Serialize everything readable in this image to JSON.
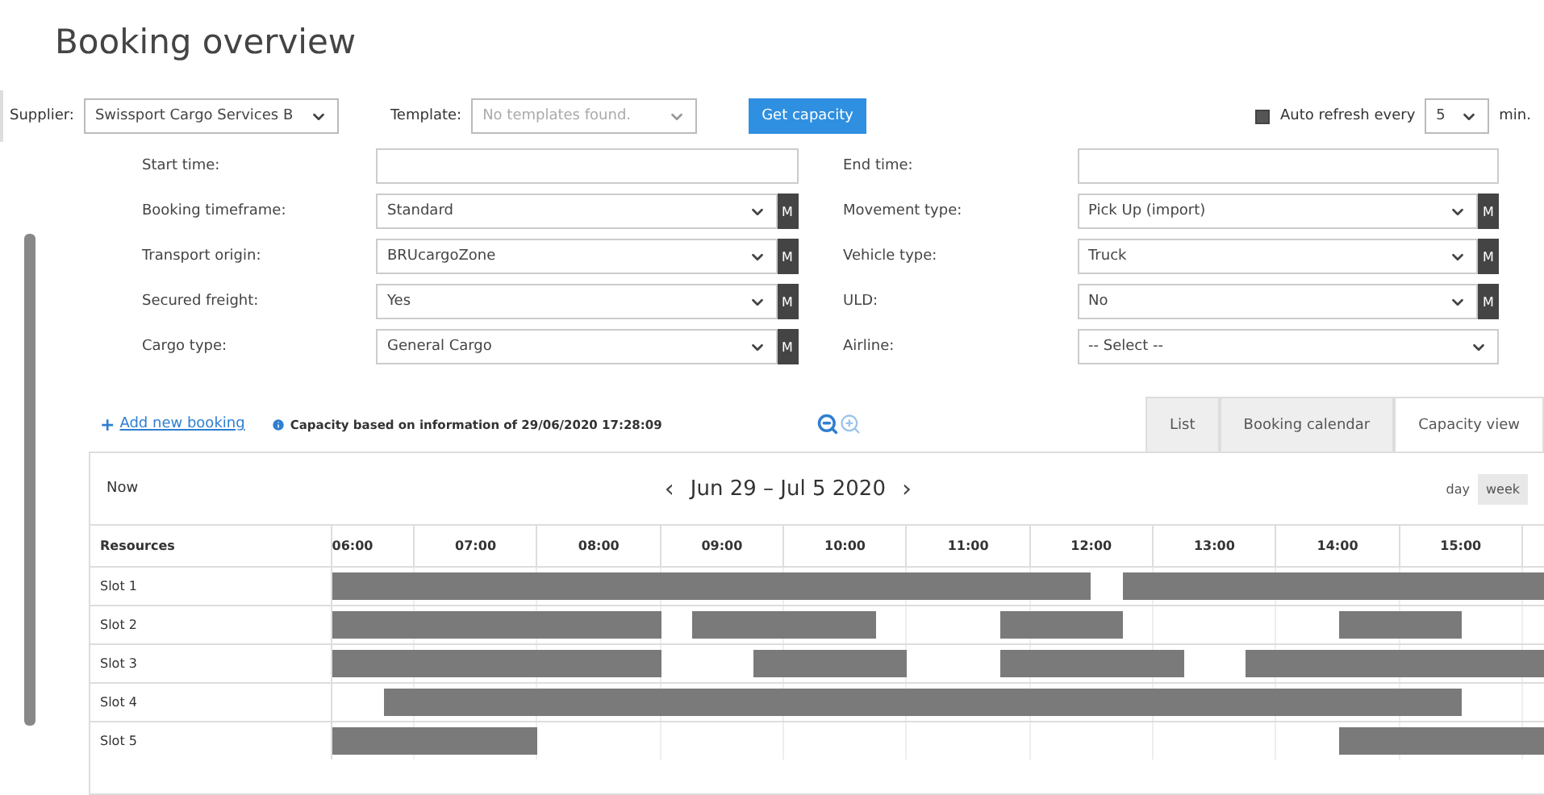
{
  "title": "Booking overview",
  "toolbar": {
    "supplier": {
      "label": "Supplier:",
      "value": "Swissport Cargo Services B"
    },
    "template": {
      "label": "Template:",
      "placeholder": "No templates found."
    },
    "get_capacity": "Get capacity",
    "auto_refresh": {
      "label": "Auto refresh every",
      "checked": true,
      "value": "5",
      "unit": "min."
    }
  },
  "form": {
    "left": [
      {
        "label": "Start time:",
        "kind": "text",
        "m_button": false
      },
      {
        "label": "Booking timeframe:",
        "kind": "select",
        "value": "Standard",
        "m_button": true,
        "m_label": "M"
      },
      {
        "label": "Transport origin:",
        "kind": "select",
        "value": "BRUcargoZone",
        "m_button": true,
        "m_label": "M"
      },
      {
        "label": "Secured freight:",
        "kind": "select",
        "value": "Yes",
        "m_button": true,
        "m_label": "M"
      },
      {
        "label": "Cargo type:",
        "kind": "select",
        "value": "General Cargo",
        "m_button": true,
        "m_label": "M"
      }
    ],
    "right": [
      {
        "label": "End time:",
        "kind": "text",
        "m_button": false
      },
      {
        "label": "Movement type:",
        "kind": "select",
        "value": "Pick Up (import)",
        "m_button": true,
        "m_label": "M"
      },
      {
        "label": "Vehicle type:",
        "kind": "select",
        "value": "Truck",
        "m_button": true,
        "m_label": "M"
      },
      {
        "label": "ULD:",
        "kind": "select",
        "value": "No",
        "m_button": true,
        "m_label": "M"
      },
      {
        "label": "Airline:",
        "kind": "select",
        "value": "-- Select --",
        "m_button": false
      }
    ]
  },
  "actions": {
    "add_booking": {
      "icon": "+",
      "label": "Add new booking"
    },
    "info": "Capacity based on information of 29/06/2020 17:28:09",
    "zoom_out": {
      "disabled": false
    },
    "zoom_in": {
      "disabled": true
    }
  },
  "view_tabs": [
    {
      "label": "List",
      "selected": false
    },
    {
      "label": "Booking calendar",
      "selected": false
    },
    {
      "label": "Capacity view",
      "selected": true
    }
  ],
  "calendar": {
    "now": "Now",
    "prev": "‹",
    "range": "Jun 29 – Jul 5 2020",
    "next": "›",
    "modes": [
      {
        "label": "day",
        "selected": false
      },
      {
        "label": "week",
        "selected": true
      }
    ],
    "resources_header": "Resources",
    "hours": [
      "06:00",
      "07:00",
      "08:00",
      "09:00",
      "10:00",
      "11:00",
      "12:00",
      "13:00",
      "14:00",
      "15:00"
    ],
    "rows": [
      {
        "name": "Slot 1"
      },
      {
        "name": "Slot 2"
      },
      {
        "name": "Slot 3"
      },
      {
        "name": "Slot 4"
      },
      {
        "name": "Slot 5"
      }
    ]
  }
}
